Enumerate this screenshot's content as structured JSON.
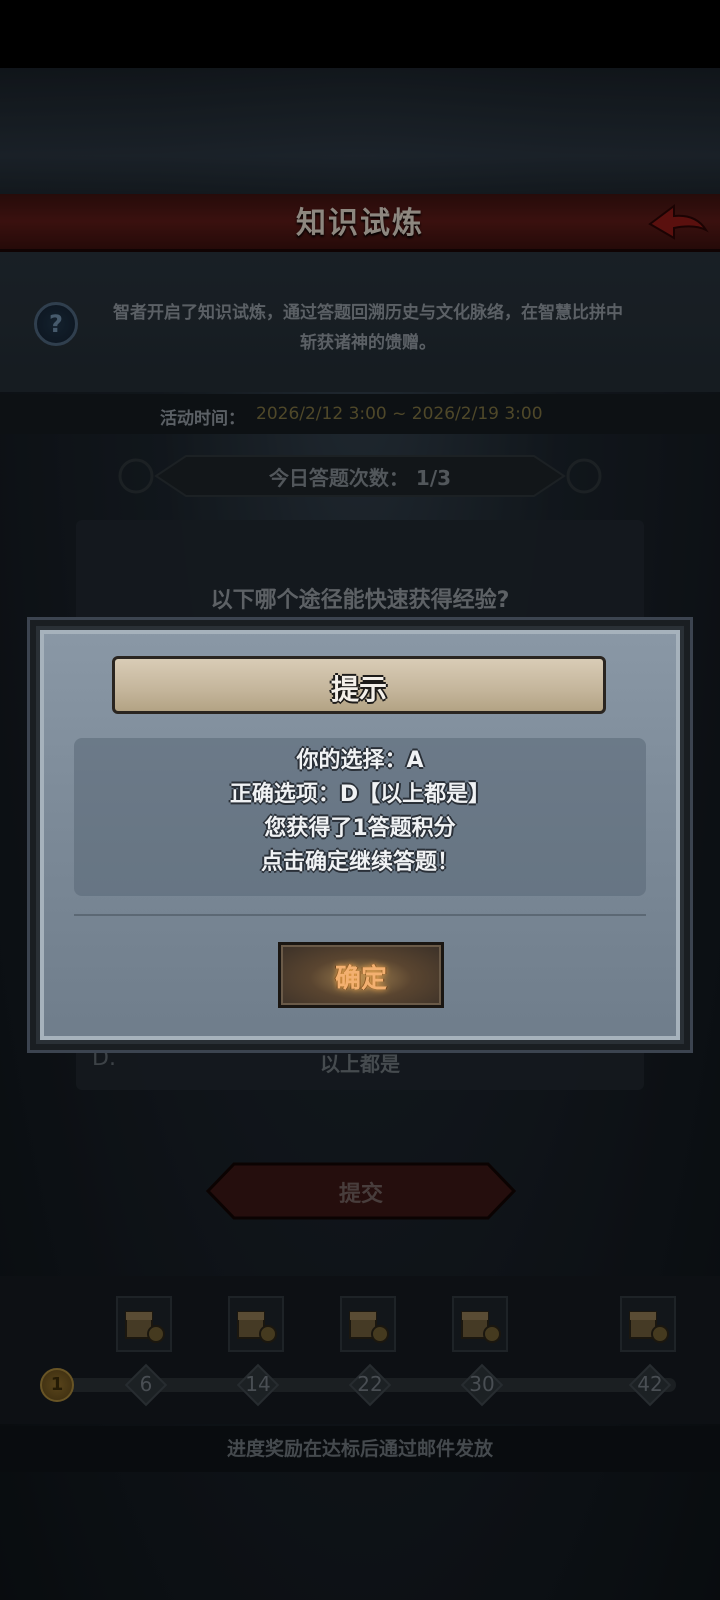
{
  "header": {
    "title": "知识试炼",
    "back_icon": "back-arrow-icon"
  },
  "info": {
    "help_icon": "?",
    "description_line1": "智者开启了知识试炼，通过答题回溯历史与文化脉络，在智慧比拼中",
    "description_line2": "斩获诸神的馈赠。"
  },
  "event_time": {
    "label": "活动时间：",
    "value": "2026/2/12 3:00 ~ 2026/2/19 3:00"
  },
  "daily_count": {
    "text": "今日答题次数： 1/3"
  },
  "question": {
    "text": "以下哪个途径能快速获得经验?",
    "visible_option_letter": "D.",
    "visible_option_text": "以上都是"
  },
  "submit": {
    "label": "提交"
  },
  "progress": {
    "current": "1",
    "current_fraction": 0.0,
    "milestones": [
      "6",
      "14",
      "22",
      "30",
      "42"
    ],
    "footer_note": "进度奖励在达标后通过邮件发放"
  },
  "dialog": {
    "title": "提示",
    "line1": "你的选择：A",
    "line2": "正确选项：D【以上都是】",
    "line3": "您获得了1答题积分",
    "line4": "点击确定继续答题！",
    "confirm_label": "确定"
  }
}
